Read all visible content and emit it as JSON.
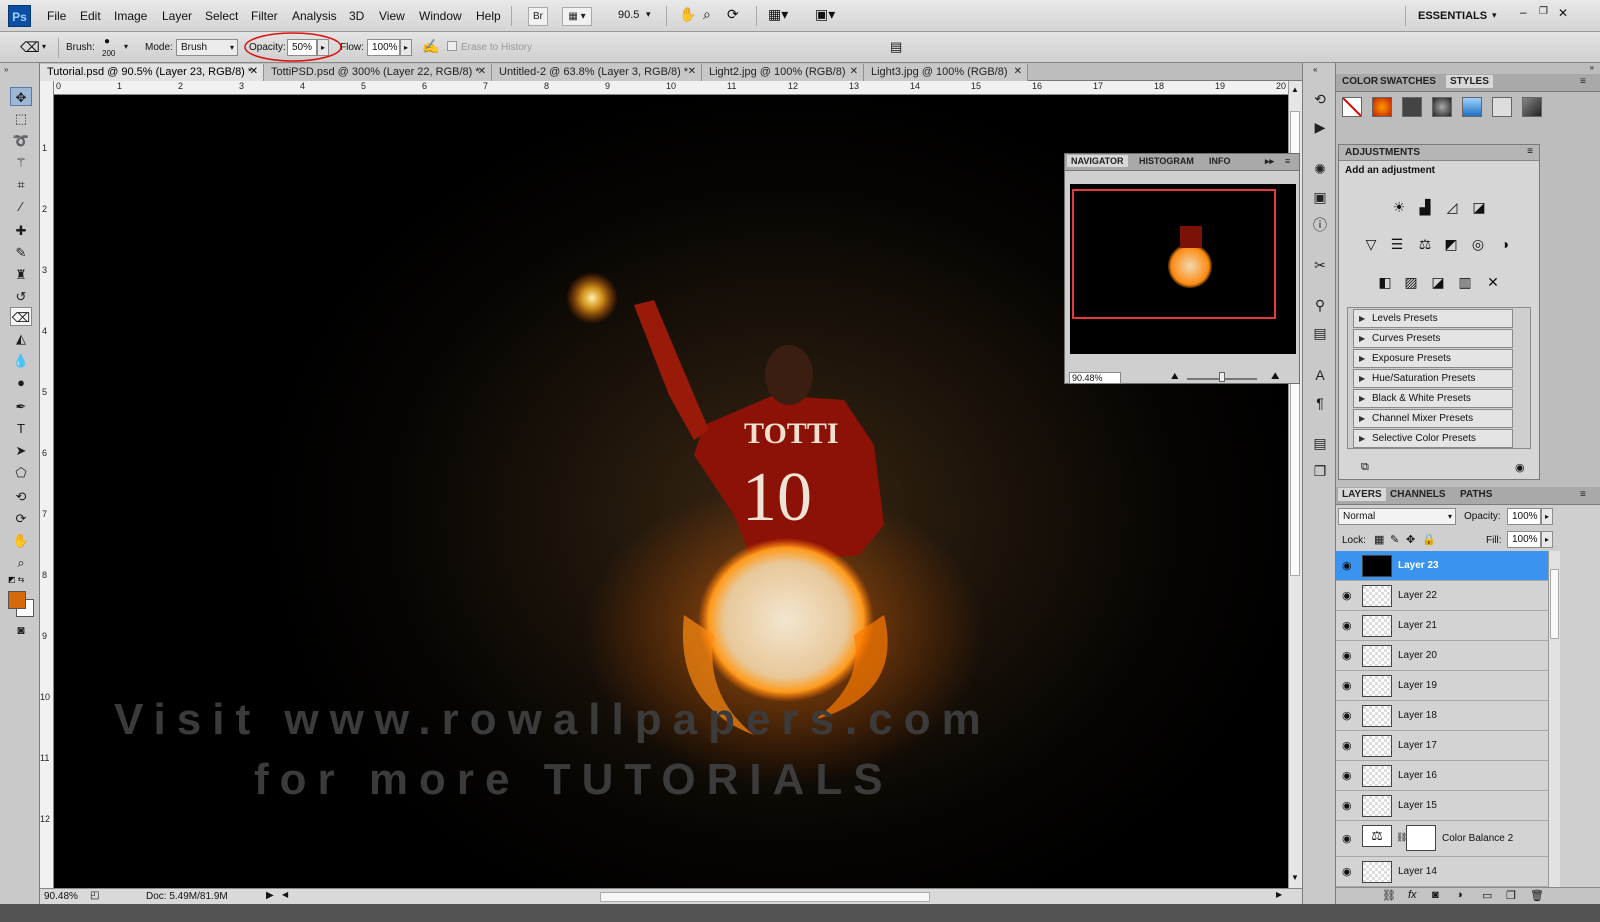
{
  "app": {
    "logo": "Ps",
    "workspace": "ESSENTIALS"
  },
  "menu": [
    "File",
    "Edit",
    "Image",
    "Layer",
    "Select",
    "Filter",
    "Analysis",
    "3D",
    "View",
    "Window",
    "Help"
  ],
  "appbar": {
    "bridge": "Br",
    "zoom": "90.5"
  },
  "options": {
    "brush_label": "Brush:",
    "brush_size": "200",
    "mode_label": "Mode:",
    "mode_value": "Brush",
    "opacity_label": "Opacity:",
    "opacity_value": "50%",
    "flow_label": "Flow:",
    "flow_value": "100%",
    "erase_history": "Erase to History"
  },
  "tabs": [
    "Tutorial.psd @ 90.5% (Layer 23, RGB/8) *",
    "TottiPSD.psd @ 300% (Layer 22, RGB/8) *",
    "Untitled-2 @ 63.8% (Layer 3, RGB/8) *",
    "Light2.jpg @ 100% (RGB/8)",
    "Light3.jpg @ 100% (RGB/8)"
  ],
  "ruler_top": [
    "0",
    "1",
    "2",
    "3",
    "4",
    "5",
    "6",
    "7",
    "8",
    "9",
    "10",
    "11",
    "12",
    "13",
    "14",
    "15",
    "16",
    "17",
    "18",
    "19",
    "20"
  ],
  "ruler_left": [
    "1",
    "2",
    "3",
    "4",
    "5",
    "6",
    "7",
    "8",
    "9",
    "10",
    "11",
    "12"
  ],
  "canvas": {
    "watermark_line1": "Visit www.rowallpapers.com",
    "watermark_line2": "for more TUTORIALS",
    "jersey_name": "TOTTI",
    "jersey_number": "10"
  },
  "status": {
    "zoom": "90.48%",
    "doc": "Doc: 5.49M/81.9M"
  },
  "color_panel": {
    "tabs": [
      "COLOR",
      "SWATCHES",
      "STYLES"
    ],
    "active": "STYLES"
  },
  "adjustments": {
    "title": "ADJUSTMENTS",
    "subtitle": "Add an adjustment",
    "presets": [
      "Levels Presets",
      "Curves Presets",
      "Exposure Presets",
      "Hue/Saturation Presets",
      "Black & White Presets",
      "Channel Mixer Presets",
      "Selective Color Presets"
    ]
  },
  "navigator": {
    "tabs": [
      "NAVIGATOR",
      "HISTOGRAM",
      "INFO"
    ],
    "zoom": "90.48%"
  },
  "layers_panel": {
    "tabs": [
      "LAYERS",
      "CHANNELS",
      "PATHS"
    ],
    "blend_mode": "Normal",
    "opacity_label": "Opacity:",
    "opacity": "100%",
    "lock_label": "Lock:",
    "fill_label": "Fill:",
    "fill": "100%",
    "layers": [
      "Layer 23",
      "Layer 22",
      "Layer 21",
      "Layer 20",
      "Layer 19",
      "Layer 18",
      "Layer 17",
      "Layer 16",
      "Layer 15",
      "Color Balance 2",
      "Layer 14"
    ],
    "selected": "Layer 23"
  },
  "colors": {
    "foreground": "#d46a0a",
    "background": "#ffffff",
    "highlight": "#3a94ef",
    "annotation": "#e01010"
  }
}
